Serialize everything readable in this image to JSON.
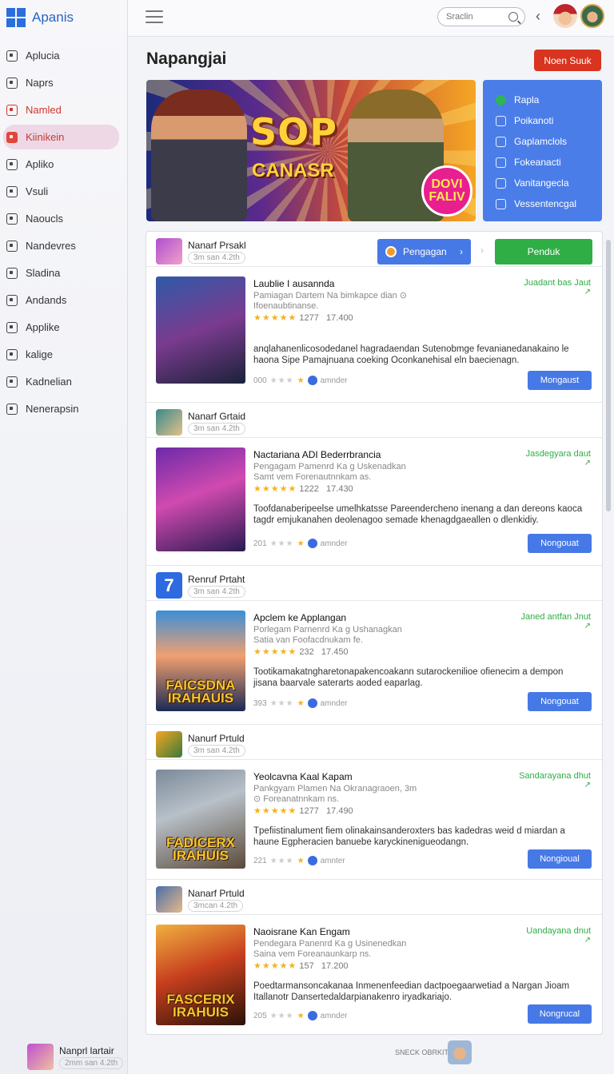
{
  "app": {
    "title": "Apanis"
  },
  "sidebar": {
    "items": [
      {
        "label": "Aplucia",
        "state": "normal"
      },
      {
        "label": "Naprs",
        "state": "normal"
      },
      {
        "label": "Namled",
        "state": "red"
      },
      {
        "label": "Kiinikein",
        "state": "active"
      },
      {
        "label": "Apliko",
        "state": "normal"
      },
      {
        "label": "Vsuli",
        "state": "normal"
      },
      {
        "label": "Naoucls",
        "state": "normal"
      },
      {
        "label": "Nandevres",
        "state": "normal"
      },
      {
        "label": "Sladina",
        "state": "normal"
      },
      {
        "label": "Andands",
        "state": "normal"
      },
      {
        "label": "Applike",
        "state": "normal"
      },
      {
        "label": "kalige",
        "state": "normal"
      },
      {
        "label": "Kadnelian",
        "state": "normal"
      },
      {
        "label": "Nenerapsin",
        "state": "normal"
      }
    ]
  },
  "topbar": {
    "search_placeholder": "Sraclin"
  },
  "main": {
    "title": "Napangjai",
    "cta_label": "Noen Suuk",
    "hero": {
      "title": "SOP",
      "subtitle": "CANASR",
      "badge_line1": "DOVI",
      "badge_line2": "FALIV"
    },
    "filters": [
      {
        "label": "Rapla",
        "checked": true
      },
      {
        "label": "Poikanoti",
        "checked": false
      },
      {
        "label": "Gaplamclols",
        "checked": false
      },
      {
        "label": "Fokeanacti",
        "checked": false
      },
      {
        "label": "Vanitangecla",
        "checked": false
      },
      {
        "label": "Vessentencgal",
        "checked": false
      }
    ]
  },
  "groups": [
    {
      "name": "Nanarf Prsakl",
      "meta": "3m san 4.2th",
      "sub_button": "Pengagan",
      "main_button": "Penduk",
      "card": {
        "title": "Laublie I ausannda",
        "subtitle": "Pamiagan Dartem Na bimkapce dian ⊙ Ifoenaubtinanse.",
        "rating": "1277",
        "rating_count": "17.400",
        "description": "anqlahanenlicosodedanel hagradaendan Sutenobmge fevanianedanakaino le haona Sipe Pamajnuana coeking Oconkanehisal eln baecienagn.",
        "footer_count": "000",
        "footer_label": "amnder",
        "status": "Juadant bas Jaut",
        "button": "Mongaust"
      }
    },
    {
      "name": "Nanarf Grtaid",
      "meta": "3m san 4.2th",
      "card": {
        "title": "Nactariana ADI Bederrbrancia",
        "subtitle": "Pengagam Pamenrd Ka g Uskenadkan Samt vem Forenautnnkam as.",
        "rating": "1222",
        "rating_count": "17.430",
        "description": "Toofdanaberipeelse umelhkatsse Pareendercheno inenang a dan dereons kaoca tagdr emjukanahen deolenagoo semade khenagdgaeallen o dlenkidiy.",
        "footer_count": "201",
        "footer_label": "amnder",
        "status": "Jasdegyara daut",
        "button": "Nongouat"
      }
    },
    {
      "name": "Renruf Prtaht",
      "meta": "3m san 4.2th",
      "number": "7",
      "card": {
        "title": "Apclem ke Applangan",
        "subtitle": "Porlegam Parnenrd Ka g Ushanagkan Satia van Foofacdnukam fe.",
        "rating": "232",
        "rating_count": "17.450",
        "description": "Tootikamakatngharetonapakencoakann sutarockenilioe ofienecim a dempon jisana baarvale saterarts aoded eaparlag.",
        "footer_count": "393",
        "footer_label": "amnder",
        "status": "Janed antfan Jnut",
        "button": "Nongouat",
        "caption": "FAICSDNA IRAHAUIS"
      }
    },
    {
      "name": "Nanurf Prtuld",
      "meta": "3m san 4.2th",
      "card": {
        "title": "Yeolcavna Kaal Kapam",
        "subtitle": "Pankgyam Plamen Na Okranagraoen, 3m ⊙ Foreanatnnkam ns.",
        "rating": "1277",
        "rating_count": "17.490",
        "description": "Tpefiistinalument fiem olinakainsanderoxters bas kadedras weid d miardan a haune Egpheracien banuebe karyckinenigueodangn.",
        "footer_count": "221",
        "footer_label": "amnter",
        "status": "Sandarayana dhut",
        "button": "Nongioual",
        "caption": "FADICERX IRAHUIS"
      }
    },
    {
      "name": "Nanarf Prtuld",
      "meta": "3mcan 4.2th",
      "card": {
        "title": "Naoisrane Kan Engam",
        "subtitle": "Pendegara Panenrd Ka g Usinenedkan Saina vem Foreanaunkarp ns.",
        "rating": "157",
        "rating_count": "17.200",
        "description": "Poedtarmansoncakanaa Inmenenfeedian dactpoegaarwetiad a Nargan Jioam Itallanotr Dansertedaldarpianakenro iryadkariajo.",
        "footer_count": "205",
        "footer_label": "amnder",
        "status": "Uandayana dnut",
        "button": "Nongrucal",
        "caption": "FASCERIX IRAHUIS"
      }
    }
  ],
  "bottom": {
    "name": "Nanprl lartair",
    "meta": "2mm san 4.2th",
    "right_text": "SNECK OBRKIT"
  }
}
